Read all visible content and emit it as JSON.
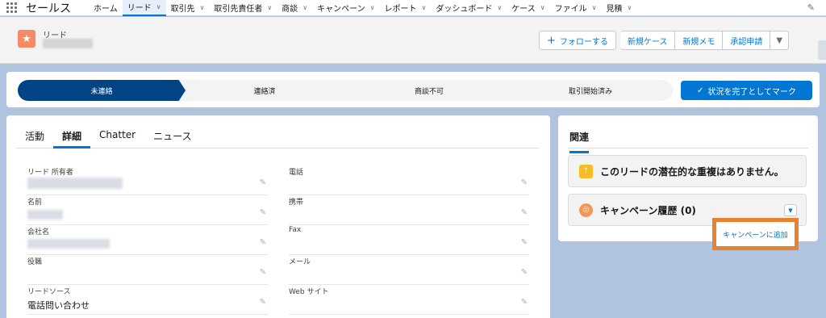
{
  "app": {
    "name": "セールス"
  },
  "nav": [
    {
      "label": "ホーム",
      "chevron": false,
      "active": false
    },
    {
      "label": "リード",
      "chevron": true,
      "active": true
    },
    {
      "label": "取引先",
      "chevron": true,
      "active": false
    },
    {
      "label": "取引先責任者",
      "chevron": true,
      "active": false
    },
    {
      "label": "商談",
      "chevron": true,
      "active": false
    },
    {
      "label": "キャンペーン",
      "chevron": true,
      "active": false
    },
    {
      "label": "レポート",
      "chevron": true,
      "active": false
    },
    {
      "label": "ダッシュボード",
      "chevron": true,
      "active": false
    },
    {
      "label": "ケース",
      "chevron": true,
      "active": false
    },
    {
      "label": "ファイル",
      "chevron": true,
      "active": false
    },
    {
      "label": "見積",
      "chevron": true,
      "active": false
    }
  ],
  "header": {
    "object_label": "リード",
    "buttons": {
      "follow": "フォローする",
      "new_case": "新規ケース",
      "new_note": "新規メモ",
      "approval": "承認申請"
    }
  },
  "path": {
    "stages": [
      "未連絡",
      "連絡済",
      "商談不可",
      "取引開始済み"
    ],
    "current": 0,
    "mark_button": "状況を完了としてマーク"
  },
  "tabs": [
    "活動",
    "詳細",
    "Chatter",
    "ニュース"
  ],
  "active_tab": 1,
  "fields_left": [
    {
      "label": "リード 所有者",
      "value": ""
    },
    {
      "label": "名前",
      "value": ""
    },
    {
      "label": "会社名",
      "value": ""
    },
    {
      "label": "役職",
      "value": ""
    },
    {
      "label": "リードソース",
      "value": "電話問い合わせ"
    }
  ],
  "fields_right": [
    {
      "label": "電話",
      "value": ""
    },
    {
      "label": "携帯",
      "value": ""
    },
    {
      "label": "Fax",
      "value": ""
    },
    {
      "label": "メール",
      "value": ""
    },
    {
      "label": "Web サイト",
      "value": ""
    }
  ],
  "related": {
    "title": "関連",
    "duplicates": "このリードの潜在的な重複はありません。",
    "campaign_history": "キャンペーン履歴 (0)",
    "add_to_campaign": "キャンペーンに追加"
  },
  "colors": {
    "brand_blue": "#0176d3",
    "current_stage": "#014486",
    "lead_icon": "#f88962",
    "campaign_icon": "#f49756",
    "duplicate_icon": "#f4bc25",
    "highlight": "#e8822e"
  },
  "icons": {
    "app_launcher": "waffle-icon",
    "lead": "star-icon",
    "follow": "plus-icon",
    "menu": "chevron-down-icon",
    "mark_complete": "check-icon",
    "edit": "pencil-icon",
    "duplicate": "duplicate-icon",
    "campaign": "campaign-icon"
  }
}
